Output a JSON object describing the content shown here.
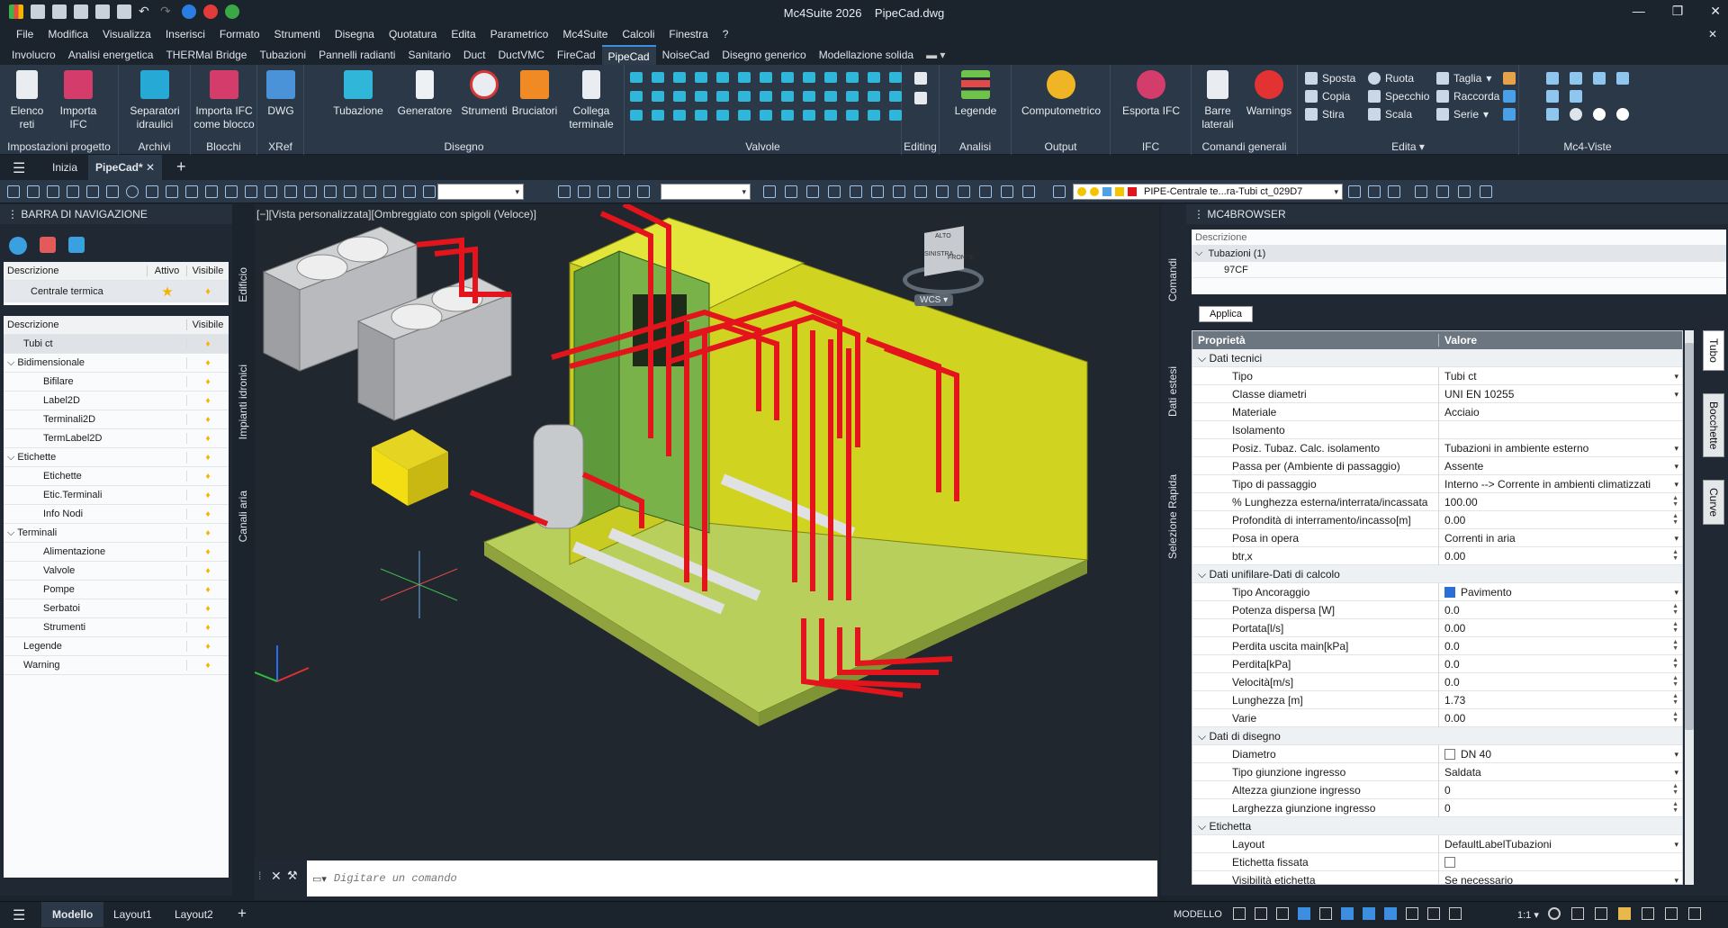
{
  "app": {
    "title": "Mc4Suite 2026",
    "document": "PipeCad.dwg"
  },
  "menu": [
    "File",
    "Modifica",
    "Visualizza",
    "Inserisci",
    "Formato",
    "Strumenti",
    "Disegna",
    "Quotatura",
    "Edita",
    "Parametrico",
    "Mc4Suite",
    "Calcoli",
    "Finestra",
    "?"
  ],
  "ribbon_tabs": [
    "Involucro",
    "Analisi energetica",
    "THERMal Bridge",
    "Tubazioni",
    "Pannelli radianti",
    "Sanitario",
    "Duct",
    "DuctVMC",
    "FireCad",
    "PipeCad",
    "NoiseCad",
    "Disegno generico",
    "Modellazione solida"
  ],
  "active_ribbon_tab": "PipeCad",
  "ribbon": {
    "impostazioni": {
      "label": "Impostazioni progetto",
      "b1": "Elenco reti",
      "b2": "Importa IFC"
    },
    "archivi": {
      "label": "Archivi",
      "b1": "Separatori idraulici"
    },
    "blocchi": {
      "label": "Blocchi",
      "b1": "Importa IFC come blocco"
    },
    "xref": {
      "label": "XRef",
      "b1": "DWG"
    },
    "disegno": {
      "label": "Disegno",
      "b1": "Tubazione",
      "b2": "Generatore",
      "b3": "Strumenti",
      "b4": "Bruciatori",
      "b5": "Collega terminale"
    },
    "valvole": {
      "label": "Valvole"
    },
    "editing": {
      "label": "Editing"
    },
    "analisi": {
      "label": "Analisi",
      "b1": "Legende"
    },
    "output": {
      "label": "Output",
      "b1": "Computometrico"
    },
    "ifc": {
      "label": "IFC",
      "b1": "Esporta IFC"
    },
    "comandi": {
      "label": "Comandi generali",
      "b1": "Barre laterali",
      "b2": "Warnings"
    },
    "edita": {
      "label": "Edita",
      "items": [
        "Sposta",
        "Ruota",
        "Taglia",
        "Copia",
        "Specchio",
        "Raccorda",
        "Stira",
        "Scala",
        "Serie"
      ]
    },
    "viste": {
      "label": "Mc4-Viste"
    }
  },
  "doc_tabs": [
    "Inizia",
    "PipeCad*"
  ],
  "layer_combo": "PIPE-Centrale te...ra-Tubi ct_029D7",
  "left_panel": {
    "title": "BARRA DI NAVIGAZIONE",
    "cols1": [
      "Descrizione",
      "Attivo",
      "Visibile"
    ],
    "row1": "Centrale termica",
    "cols2": [
      "Descrizione",
      "Visibile"
    ],
    "tree": [
      {
        "label": "Tubi ct",
        "level": 0,
        "sel": true
      },
      {
        "label": "Bidimensionale",
        "level": 0,
        "exp": true
      },
      {
        "label": "Bifilare",
        "level": 1
      },
      {
        "label": "Label2D",
        "level": 1
      },
      {
        "label": "Terminali2D",
        "level": 1
      },
      {
        "label": "TermLabel2D",
        "level": 1
      },
      {
        "label": "Etichette",
        "level": 0,
        "exp": true
      },
      {
        "label": "Etichette",
        "level": 1
      },
      {
        "label": "Etic.Terminali",
        "level": 1
      },
      {
        "label": "Info Nodi",
        "level": 1
      },
      {
        "label": "Terminali",
        "level": 0,
        "exp": true
      },
      {
        "label": "Alimentazione",
        "level": 1
      },
      {
        "label": "Valvole",
        "level": 1
      },
      {
        "label": "Pompe",
        "level": 1
      },
      {
        "label": "Serbatoi",
        "level": 1
      },
      {
        "label": "Strumenti",
        "level": 1
      },
      {
        "label": "Legende",
        "level": 0
      },
      {
        "label": "Warning",
        "level": 0
      }
    ],
    "side_tabs": [
      "Edificio",
      "Impianti idronici",
      "Canali aria"
    ]
  },
  "viewport": {
    "label": "[−][Vista personalizzata][Ombreggiato con spigoli (Veloce)]",
    "wcs": "WCS",
    "cube_top": "ALTO",
    "cube_left": "SINISTRA",
    "cube_right": "FRONTE"
  },
  "command": {
    "placeholder": "Digitare un comando"
  },
  "right_strip": [
    "Comandi",
    "Dati estesi",
    "Selezione Rapida"
  ],
  "browser": {
    "title": "MC4BROWSER",
    "desc": "Descrizione",
    "node": "Tubazioni (1)",
    "child": "97CF",
    "apply": "Applica",
    "col_prop": "Proprietà",
    "col_val": "Valore",
    "side_tabs": [
      "Tubo",
      "Bocchette",
      "Curve"
    ]
  },
  "properties": [
    {
      "sec": "Dati tecnici"
    },
    {
      "n": "Tipo",
      "v": "Tubi ct",
      "dd": true
    },
    {
      "n": "Classe diametri",
      "v": "UNI EN 10255",
      "dd": true
    },
    {
      "n": "Materiale",
      "v": "Acciaio"
    },
    {
      "n": "Isolamento",
      "v": ""
    },
    {
      "n": "Posiz. Tubaz. Calc. isolamento",
      "v": "Tubazioni in ambiente esterno",
      "dd": true
    },
    {
      "n": "Passa per (Ambiente di passaggio)",
      "v": "Assente",
      "dd": true
    },
    {
      "n": "Tipo di passaggio",
      "v": "Interno --> Corrente in ambienti climatizzati",
      "dd": true
    },
    {
      "n": "% Lunghezza esterna/interrata/incassata",
      "v": "100.00",
      "sp": true
    },
    {
      "n": "Profondità di interramento/incasso[m]",
      "v": "0.00",
      "sp": true
    },
    {
      "n": "Posa in opera",
      "v": "Correnti in aria",
      "dd": true
    },
    {
      "n": "btr,x",
      "v": "0.00",
      "sp": true
    },
    {
      "sec": "Dati unifilare-Dati di calcolo"
    },
    {
      "n": "Tipo Ancoraggio",
      "v": "Pavimento",
      "cb": "on",
      "dd": true
    },
    {
      "n": "Potenza dispersa [W]",
      "v": "0.0",
      "sp": true
    },
    {
      "n": "Portata[l/s]",
      "v": "0.00",
      "sp": true
    },
    {
      "n": "Perdita uscita main[kPa]",
      "v": "0.0",
      "sp": true
    },
    {
      "n": "Perdita[kPa]",
      "v": "0.0",
      "sp": true
    },
    {
      "n": "Velocità[m/s]",
      "v": "0.0",
      "sp": true
    },
    {
      "n": "Lunghezza [m]",
      "v": "1.73",
      "sp": true
    },
    {
      "n": "Varie",
      "v": "0.00",
      "sp": true
    },
    {
      "sec": "Dati di disegno"
    },
    {
      "n": "Diametro",
      "v": "DN 40",
      "cb": "off",
      "dd": true
    },
    {
      "n": "Tipo giunzione ingresso",
      "v": "Saldata",
      "dd": true
    },
    {
      "n": "Altezza giunzione ingresso",
      "v": "0",
      "sp": true
    },
    {
      "n": "Larghezza giunzione ingresso",
      "v": "0",
      "sp": true
    },
    {
      "sec": "Etichetta"
    },
    {
      "n": "Layout",
      "v": "DefaultLabelTubazioni",
      "dd": true
    },
    {
      "n": "Etichetta fissata",
      "v": "",
      "cb": "off"
    },
    {
      "n": "Visibilità etichetta",
      "v": "Se necessario",
      "dd": true
    }
  ],
  "status": {
    "tabs": [
      "Modello",
      "Layout1",
      "Layout2"
    ],
    "mode": "MODELLO",
    "scale": "1:1"
  },
  "colors": {
    "accent": "#3c8fe0",
    "pipe": "#e3141b",
    "wall": "#c9cc1a",
    "floor": "#b7cf5a"
  }
}
